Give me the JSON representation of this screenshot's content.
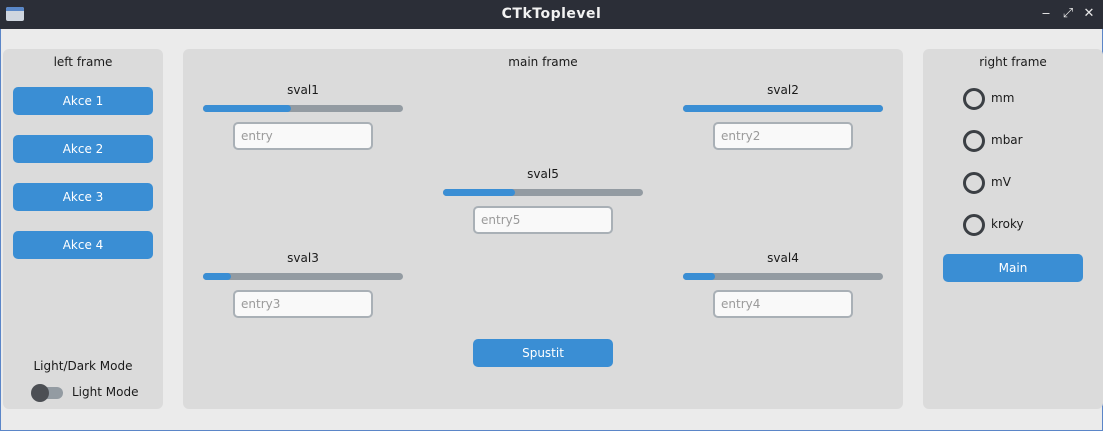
{
  "window": {
    "title": "CTkToplevel",
    "controls": {
      "minimize": "‒",
      "maximize": "⤢",
      "close": "✕"
    }
  },
  "left_frame": {
    "title": "left frame",
    "buttons": [
      "Akce 1",
      "Akce 2",
      "Akce 3",
      "Akce 4"
    ],
    "appearance_label": "Light/Dark Mode",
    "switch_label": "Light Mode",
    "switch_on": false
  },
  "main_frame": {
    "title": "main frame",
    "sliders": [
      {
        "label": "sval1",
        "value": 0.44,
        "entry_placeholder": "entry"
      },
      {
        "label": "sval2",
        "value": 1.0,
        "entry_placeholder": "entry2"
      },
      {
        "label": "sval5",
        "value": 0.36,
        "entry_placeholder": "entry5"
      },
      {
        "label": "sval3",
        "value": 0.14,
        "entry_placeholder": "entry3"
      },
      {
        "label": "sval4",
        "value": 0.16,
        "entry_placeholder": "entry4"
      }
    ],
    "run_button": "Spustit"
  },
  "right_frame": {
    "title": "right frame",
    "radios": [
      "mm",
      "mbar",
      "mV",
      "kroky"
    ],
    "selected_radio": null,
    "main_button": "Main"
  },
  "colors": {
    "accent": "#3a8ed4",
    "titlebar": "#2b2e37",
    "frame_bg": "#dbdbdb",
    "window_bg": "#ebebeb",
    "slider_track": "#939ba2"
  }
}
